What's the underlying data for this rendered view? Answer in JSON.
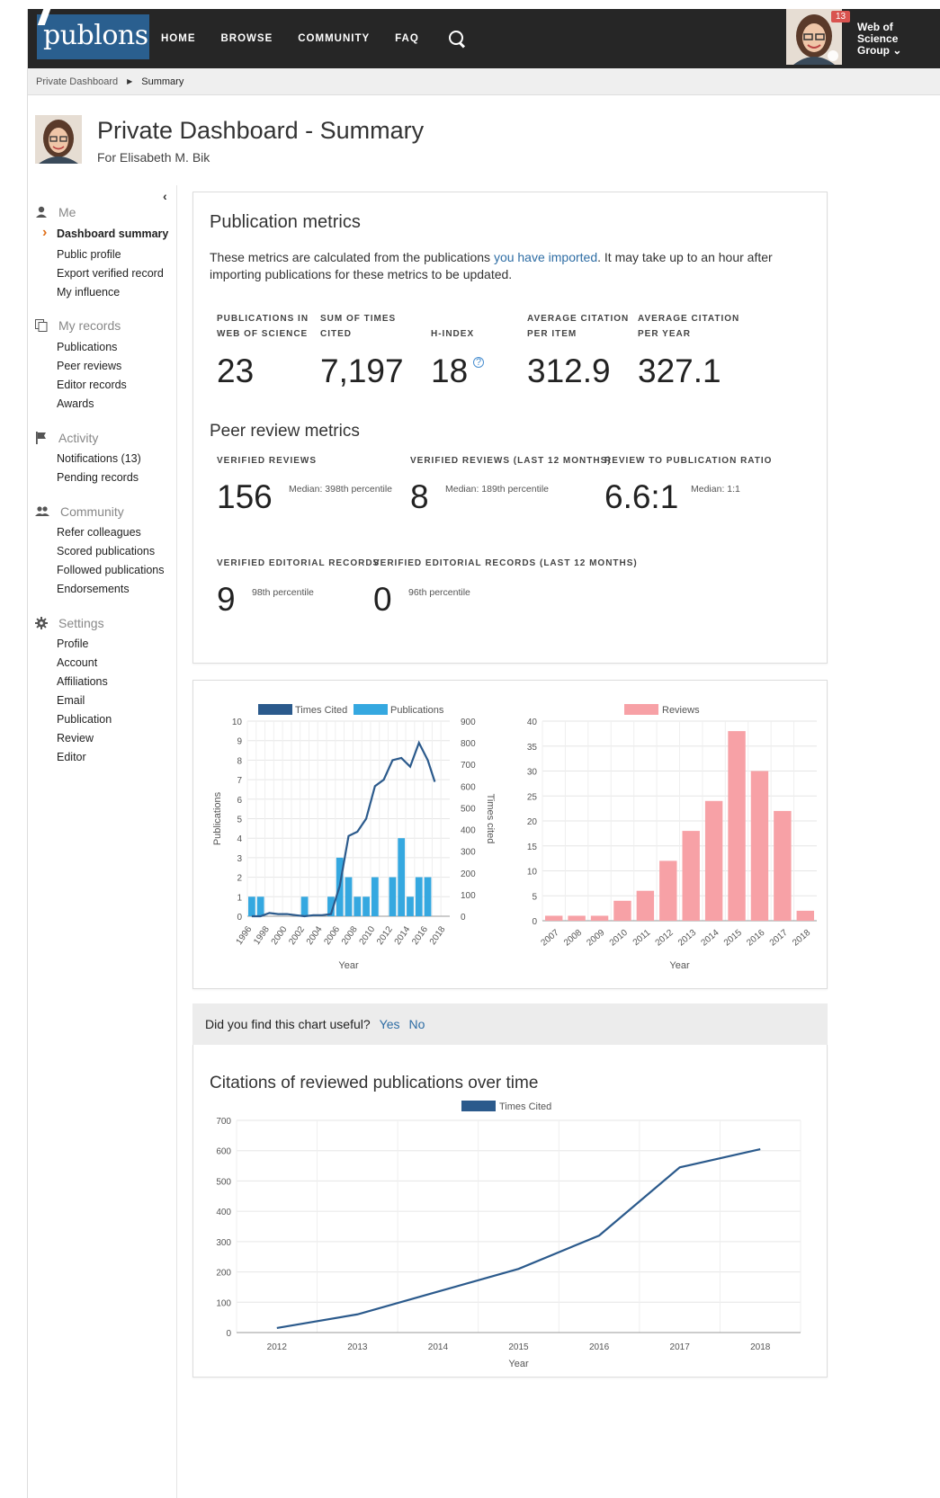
{
  "nav": {
    "logo": "publons",
    "links": [
      "HOME",
      "BROWSE",
      "COMMUNITY",
      "FAQ"
    ],
    "notification_count": "13",
    "org": [
      "Web of",
      "Science",
      "Group ⌄"
    ]
  },
  "breadcrumb": {
    "parent": "Private Dashboard",
    "current": "Summary"
  },
  "header": {
    "title": "Private Dashboard - Summary",
    "subtitle": "For Elisabeth M. Bik"
  },
  "sidebar": {
    "sections": [
      {
        "label": "Me",
        "icon": "person-icon",
        "items": [
          "Dashboard summary",
          "Public profile",
          "Export verified record",
          "My influence"
        ]
      },
      {
        "label": "My records",
        "icon": "copy-icon",
        "items": [
          "Publications",
          "Peer reviews",
          "Editor records",
          "Awards"
        ]
      },
      {
        "label": "Activity",
        "icon": "flag-icon",
        "items": [
          "Notifications (13)",
          "Pending records"
        ]
      },
      {
        "label": "Community",
        "icon": "people-icon",
        "items": [
          "Refer colleagues",
          "Scored publications",
          "Followed publications",
          "Endorsements"
        ]
      },
      {
        "label": "Settings",
        "icon": "gear-icon",
        "items": [
          "Profile",
          "Account",
          "Affiliations",
          "Email",
          "Publication",
          "Review",
          "Editor"
        ]
      }
    ]
  },
  "pub_metrics": {
    "title": "Publication metrics",
    "desc_before": "These metrics are calculated from the publications ",
    "desc_link": "you have imported",
    "desc_after": ".  It may take up to an hour after importing publications for these metrics to be updated.",
    "labels": [
      "PUBLICATIONS IN\nWEB OF SCIENCE",
      "SUM OF TIMES\nCITED",
      "H-INDEX",
      "AVERAGE CITATION\nPER ITEM",
      "AVERAGE CITATION\nPER YEAR"
    ],
    "values": [
      "23",
      "7,197",
      "18",
      "312.9",
      "327.1"
    ]
  },
  "peer_metrics": {
    "title": "Peer review metrics",
    "labels": [
      "VERIFIED REVIEWS",
      "VERIFIED REVIEWS (LAST 12 MONTHS)",
      "REVIEW TO PUBLICATION RATIO"
    ],
    "values": [
      "156",
      "8",
      "6.6:1"
    ],
    "medians": [
      "Median: 398th percentile",
      "Median: 189th percentile",
      "Median: 1:1"
    ],
    "editorial_labels": [
      "VERIFIED EDITORIAL RECORDS",
      "VERIFIED EDITORIAL RECORDS (LAST 12 MONTHS)"
    ],
    "editorial_values": [
      "9",
      "0"
    ],
    "editorial_pct": [
      "98th percentile",
      "96th percentile"
    ]
  },
  "feedback": {
    "question": "Did you find this chart useful?",
    "yes": "Yes",
    "no": "No"
  },
  "chart_data": [
    {
      "type": "bar",
      "legend": [
        "Times Cited",
        "Publications"
      ],
      "xlabel": "Year",
      "ylabel": "Publications",
      "y2label": "Times cited",
      "ylim": [
        0,
        10
      ],
      "y2lim": [
        0,
        900
      ],
      "yticks": [
        0,
        1,
        2,
        3,
        4,
        5,
        6,
        7,
        8,
        9,
        10
      ],
      "y2ticks": [
        0,
        100,
        200,
        300,
        400,
        500,
        600,
        700,
        800,
        900
      ],
      "x": [
        1996,
        1997,
        1998,
        1999,
        2000,
        2001,
        2002,
        2003,
        2004,
        2005,
        2006,
        2007,
        2008,
        2009,
        2010,
        2011,
        2012,
        2013,
        2014,
        2015,
        2016,
        2017,
        2018
      ],
      "xtick_labels": [
        "1996",
        "1998",
        "2000",
        "2002",
        "2004",
        "2006",
        "2008",
        "2010",
        "2012",
        "2014",
        "2016",
        "2018"
      ],
      "series": [
        {
          "name": "Publications",
          "type": "bar",
          "values": [
            1,
            1,
            0,
            0,
            0,
            0,
            1,
            0,
            0,
            1,
            3,
            2,
            1,
            1,
            2,
            0,
            2,
            4,
            1,
            2,
            2,
            0,
            0
          ]
        },
        {
          "name": "Times Cited",
          "type": "line",
          "values": [
            0,
            0,
            15,
            10,
            10,
            5,
            0,
            5,
            5,
            10,
            140,
            370,
            390,
            450,
            600,
            630,
            720,
            730,
            690,
            800,
            720,
            0,
            0
          ]
        }
      ],
      "line_points": [
        [
          1996,
          0
        ],
        [
          1997,
          0
        ],
        [
          1998,
          15
        ],
        [
          1999,
          10
        ],
        [
          2000,
          10
        ],
        [
          2001,
          5
        ],
        [
          2002,
          0
        ],
        [
          2003,
          5
        ],
        [
          2004,
          5
        ],
        [
          2005,
          10
        ],
        [
          2006,
          140
        ],
        [
          2007,
          370
        ],
        [
          2008,
          390
        ],
        [
          2009,
          450
        ],
        [
          2010,
          600
        ],
        [
          2011,
          630
        ],
        [
          2012,
          720
        ],
        [
          2013,
          730
        ],
        [
          2014,
          690
        ],
        [
          2015,
          800
        ],
        [
          2016,
          720
        ],
        [
          2016.8,
          620
        ]
      ]
    },
    {
      "type": "bar",
      "legend": [
        "Reviews"
      ],
      "xlabel": "Year",
      "ylim": [
        0,
        40
      ],
      "yticks": [
        0,
        5,
        10,
        15,
        20,
        25,
        30,
        35,
        40
      ],
      "categories": [
        "2007",
        "2008",
        "2009",
        "2010",
        "2011",
        "2012",
        "2013",
        "2014",
        "2015",
        "2016",
        "2017",
        "2018"
      ],
      "values": [
        1,
        1,
        1,
        4,
        6,
        12,
        18,
        24,
        38,
        30,
        22,
        2
      ]
    },
    {
      "type": "line",
      "title": "Citations of reviewed publications over time",
      "legend": [
        "Times Cited"
      ],
      "xlabel": "Year",
      "ylim": [
        0,
        700
      ],
      "yticks": [
        0,
        100,
        200,
        300,
        400,
        500,
        600,
        700
      ],
      "categories": [
        "2012",
        "2013",
        "2014",
        "2015",
        "2016",
        "2017",
        "2018"
      ],
      "values": [
        15,
        60,
        135,
        210,
        320,
        545,
        605
      ]
    }
  ]
}
